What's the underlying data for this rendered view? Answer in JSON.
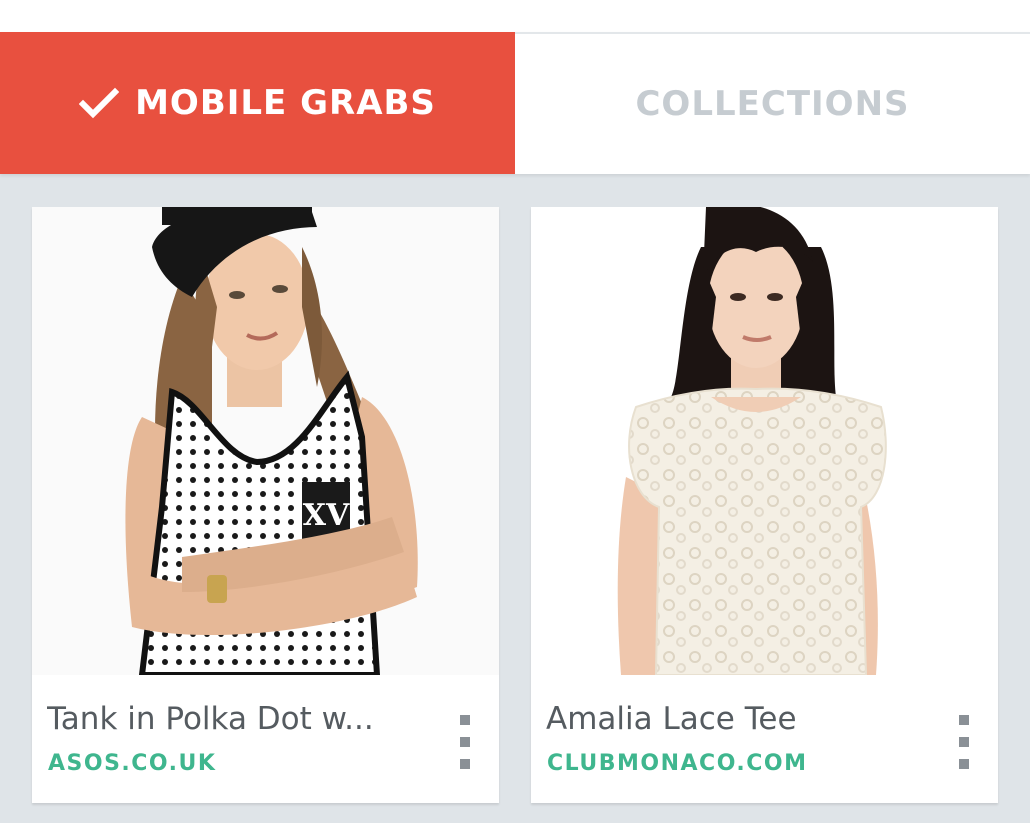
{
  "tabs": [
    {
      "label": "MOBILE GRABS",
      "active": true,
      "icon": "check-icon"
    },
    {
      "label": "COLLECTIONS",
      "active": false
    }
  ],
  "colors": {
    "accent": "#e8503f",
    "source_link": "#3fb68e",
    "inactive_tab_text": "#c6ccd1",
    "background": "#dfe4e8"
  },
  "cards": [
    {
      "title": "Tank in Polka Dot w...",
      "source": "ASOS.CO.UK",
      "image": "woman-in-polka-dot-tank-photo",
      "menu_icon": "more-vertical-icon"
    },
    {
      "title": "Amalia Lace Tee",
      "source": "CLUBMONACO.COM",
      "image": "woman-in-lace-tee-photo",
      "menu_icon": "more-vertical-icon"
    }
  ]
}
